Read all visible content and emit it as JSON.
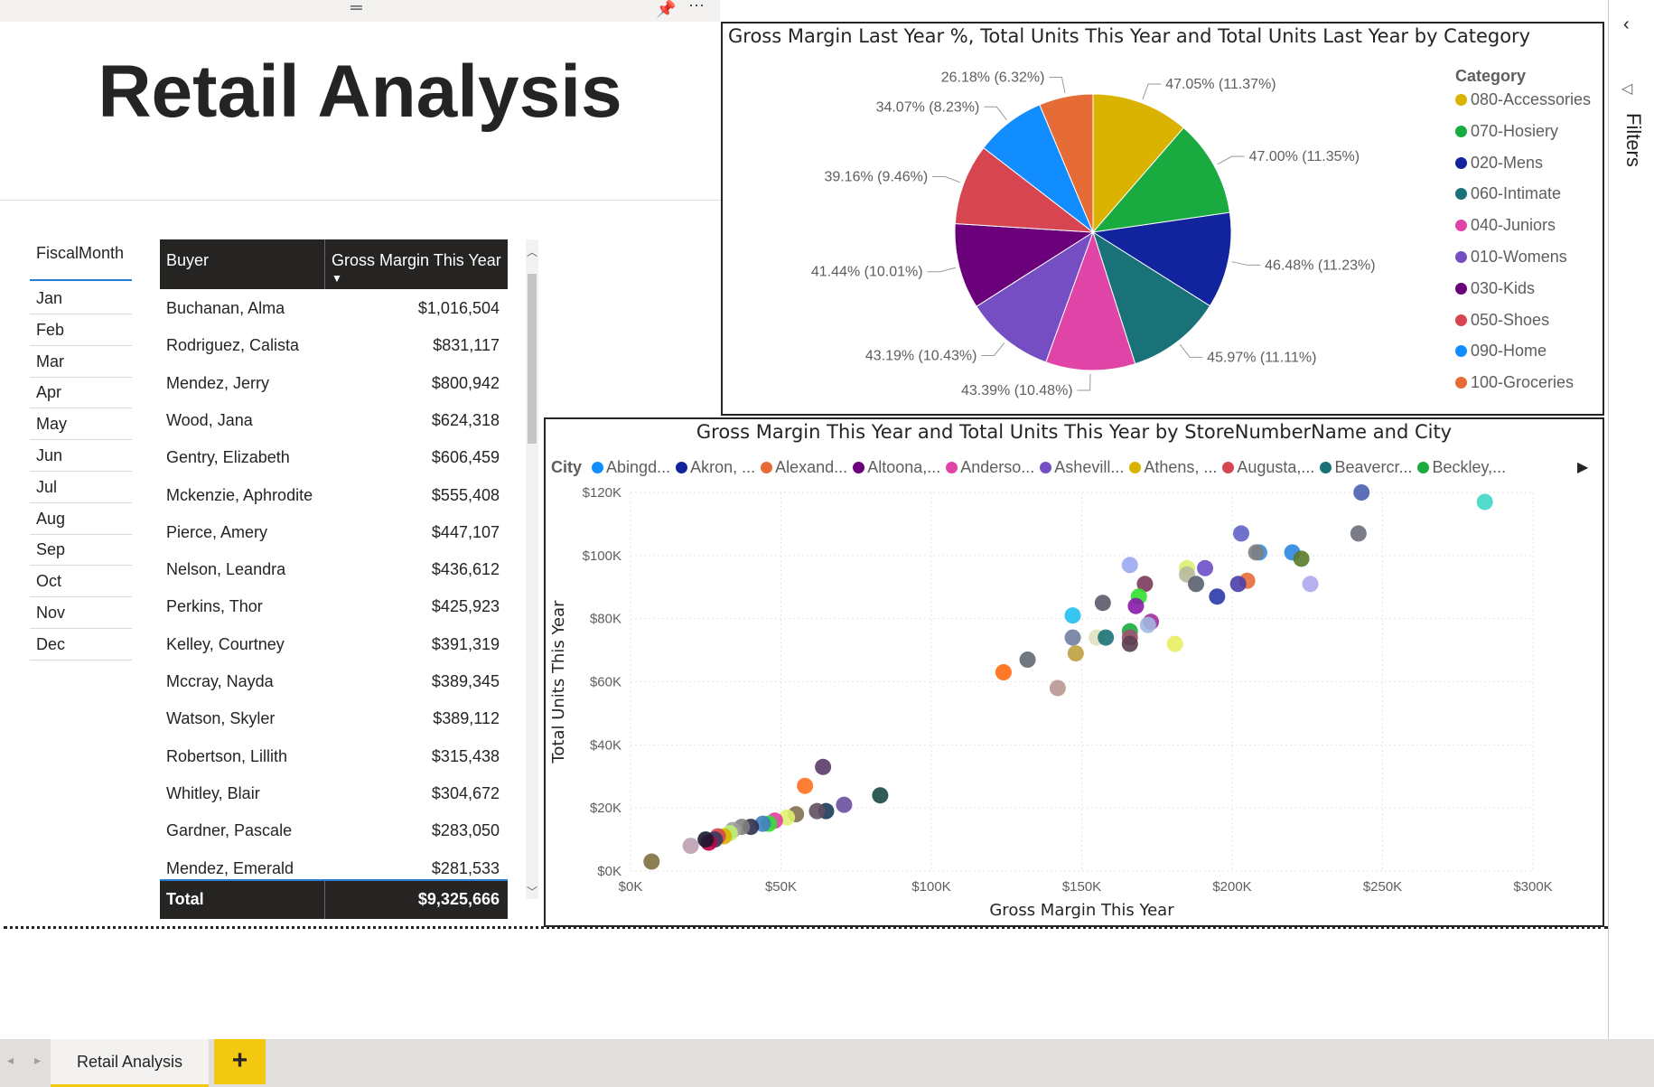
{
  "report": {
    "title": "Retail Analysis"
  },
  "slicer": {
    "title": "FiscalMonth",
    "items": [
      "Jan",
      "Feb",
      "Mar",
      "Apr",
      "May",
      "Jun",
      "Jul",
      "Aug",
      "Sep",
      "Oct",
      "Nov",
      "Dec"
    ]
  },
  "table": {
    "headers": {
      "buyer": "Buyer",
      "gross_margin": "Gross Margin This Year"
    },
    "rows": [
      {
        "buyer": "Buchanan, Alma",
        "gm": "$1,016,504"
      },
      {
        "buyer": "Rodriguez, Calista",
        "gm": "$831,117"
      },
      {
        "buyer": "Mendez, Jerry",
        "gm": "$800,942"
      },
      {
        "buyer": "Wood, Jana",
        "gm": "$624,318"
      },
      {
        "buyer": "Gentry, Elizabeth",
        "gm": "$606,459"
      },
      {
        "buyer": "Mckenzie, Aphrodite",
        "gm": "$555,408"
      },
      {
        "buyer": "Pierce, Amery",
        "gm": "$447,107"
      },
      {
        "buyer": "Nelson, Leandra",
        "gm": "$436,612"
      },
      {
        "buyer": "Perkins, Thor",
        "gm": "$425,923"
      },
      {
        "buyer": "Kelley, Courtney",
        "gm": "$391,319"
      },
      {
        "buyer": "Mccray, Nayda",
        "gm": "$389,345"
      },
      {
        "buyer": "Watson, Skyler",
        "gm": "$389,112"
      },
      {
        "buyer": "Robertson, Lillith",
        "gm": "$315,438"
      },
      {
        "buyer": "Whitley, Blair",
        "gm": "$304,672"
      },
      {
        "buyer": "Gardner, Pascale",
        "gm": "$283,050"
      },
      {
        "buyer": "Mendez, Emerald",
        "gm": "$281,533"
      }
    ],
    "total": {
      "label": "Total",
      "value": "$9,325,666"
    }
  },
  "filters": {
    "label": "Filters"
  },
  "tabs": {
    "active": "Retail Analysis",
    "add": "+"
  },
  "chart_data": [
    {
      "type": "pie",
      "title": "Gross Margin Last Year %, Total Units This Year and Total Units Last Year by Category",
      "legend_title": "Category",
      "legend_position": "right",
      "categories": [
        "080-Accessories",
        "070-Hosiery",
        "020-Mens",
        "060-Intimate",
        "040-Juniors",
        "010-Womens",
        "030-Kids",
        "050-Shoes",
        "090-Home",
        "100-Groceries"
      ],
      "colors": [
        "#d9b300",
        "#1aab40",
        "#12239e",
        "#197278",
        "#e044a7",
        "#744ec2",
        "#6b007b",
        "#d64550",
        "#118dff",
        "#e66c37"
      ],
      "values": [
        11.37,
        11.35,
        11.23,
        11.11,
        10.48,
        10.43,
        10.01,
        9.46,
        8.23,
        6.32
      ],
      "data_labels": [
        "47.05% (11.37%)",
        "47.00% (11.35%)",
        "46.48% (11.23%)",
        "45.97% (11.11%)",
        "43.39% (10.48%)",
        "43.19% (10.43%)",
        "41.44% (10.01%)",
        "39.16% (9.46%)",
        "34.07% (8.23%)",
        "26.18% (6.32%)"
      ]
    },
    {
      "type": "scatter",
      "title": "Gross Margin This Year and Total Units This Year by StoreNumberName and City",
      "xlabel": "Gross Margin This Year",
      "ylabel": "Total Units This Year",
      "xlim": [
        0,
        300000
      ],
      "ylim": [
        0,
        120000
      ],
      "x_ticks": [
        "$0K",
        "$50K",
        "$100K",
        "$150K",
        "$200K",
        "$250K",
        "$300K"
      ],
      "y_ticks": [
        "$0K",
        "$20K",
        "$40K",
        "$60K",
        "$80K",
        "$100K",
        "$120K"
      ],
      "legend_title": "City",
      "legend_position": "top",
      "legend": [
        {
          "name": "Abingd...",
          "color": "#118dff"
        },
        {
          "name": "Akron, ...",
          "color": "#12239e"
        },
        {
          "name": "Alexand...",
          "color": "#e66c37"
        },
        {
          "name": "Altoona,...",
          "color": "#6b007b"
        },
        {
          "name": "Anderso...",
          "color": "#e044a7"
        },
        {
          "name": "Ashevill...",
          "color": "#744ec2"
        },
        {
          "name": "Athens, ...",
          "color": "#d9b300"
        },
        {
          "name": "Augusta,...",
          "color": "#d64550"
        },
        {
          "name": "Beavercr...",
          "color": "#197278"
        },
        {
          "name": "Beckley,...",
          "color": "#1aab40"
        }
      ],
      "points": [
        {
          "x": 243000,
          "y": 120000,
          "color": "#4a5fb0"
        },
        {
          "x": 284000,
          "y": 117000,
          "color": "#3fd6c6"
        },
        {
          "x": 242000,
          "y": 107000,
          "color": "#6b6f7a"
        },
        {
          "x": 203000,
          "y": 107000,
          "color": "#6060c8"
        },
        {
          "x": 220000,
          "y": 101000,
          "color": "#2b86e0"
        },
        {
          "x": 209000,
          "y": 101000,
          "color": "#3b8ee8"
        },
        {
          "x": 208000,
          "y": 101000,
          "color": "#808080"
        },
        {
          "x": 223000,
          "y": 99000,
          "color": "#5a7a2a"
        },
        {
          "x": 166000,
          "y": 97000,
          "color": "#9aa8f0"
        },
        {
          "x": 185000,
          "y": 96000,
          "color": "#d8f070"
        },
        {
          "x": 191000,
          "y": 96000,
          "color": "#6a4fc8"
        },
        {
          "x": 185000,
          "y": 94000,
          "color": "#b8b8a0"
        },
        {
          "x": 205000,
          "y": 92000,
          "color": "#e66c37"
        },
        {
          "x": 171000,
          "y": 91000,
          "color": "#7a3a5a"
        },
        {
          "x": 188000,
          "y": 91000,
          "color": "#5a6070"
        },
        {
          "x": 202000,
          "y": 91000,
          "color": "#4a3ea8"
        },
        {
          "x": 226000,
          "y": 91000,
          "color": "#b0a8f0"
        },
        {
          "x": 195000,
          "y": 87000,
          "color": "#2a3aa8"
        },
        {
          "x": 169000,
          "y": 87000,
          "color": "#30e030"
        },
        {
          "x": 157000,
          "y": 85000,
          "color": "#5a5a6a"
        },
        {
          "x": 168000,
          "y": 84000,
          "color": "#8a1aa8"
        },
        {
          "x": 147000,
          "y": 81000,
          "color": "#20c0f0"
        },
        {
          "x": 173000,
          "y": 79000,
          "color": "#a030a0"
        },
        {
          "x": 172000,
          "y": 78000,
          "color": "#a0b8e0"
        },
        {
          "x": 166000,
          "y": 76000,
          "color": "#1aab40"
        },
        {
          "x": 155000,
          "y": 74000,
          "color": "#e0e0c0"
        },
        {
          "x": 158000,
          "y": 74000,
          "color": "#197278"
        },
        {
          "x": 147000,
          "y": 74000,
          "color": "#7080a0"
        },
        {
          "x": 166000,
          "y": 74000,
          "color": "#a05070"
        },
        {
          "x": 166000,
          "y": 72000,
          "color": "#5a4050"
        },
        {
          "x": 181000,
          "y": 72000,
          "color": "#e8f060"
        },
        {
          "x": 148000,
          "y": 69000,
          "color": "#c0a040"
        },
        {
          "x": 132000,
          "y": 67000,
          "color": "#606870"
        },
        {
          "x": 124000,
          "y": 63000,
          "color": "#ff6a10"
        },
        {
          "x": 142000,
          "y": 58000,
          "color": "#b89890"
        },
        {
          "x": 83000,
          "y": 24000,
          "color": "#1a4a40"
        },
        {
          "x": 64000,
          "y": 33000,
          "color": "#5a3a6a"
        },
        {
          "x": 58000,
          "y": 27000,
          "color": "#ff7020"
        },
        {
          "x": 71000,
          "y": 21000,
          "color": "#6a4fa0"
        },
        {
          "x": 65000,
          "y": 19000,
          "color": "#1a3a5a"
        },
        {
          "x": 62000,
          "y": 19000,
          "color": "#605060"
        },
        {
          "x": 55000,
          "y": 18000,
          "color": "#807050"
        },
        {
          "x": 52000,
          "y": 17000,
          "color": "#e0f070"
        },
        {
          "x": 48000,
          "y": 16000,
          "color": "#e040a0"
        },
        {
          "x": 46000,
          "y": 15000,
          "color": "#30e030"
        },
        {
          "x": 44000,
          "y": 15000,
          "color": "#4080c0"
        },
        {
          "x": 40000,
          "y": 14000,
          "color": "#303050"
        },
        {
          "x": 37000,
          "y": 14000,
          "color": "#808080"
        },
        {
          "x": 34000,
          "y": 13000,
          "color": "#a0a0a0"
        },
        {
          "x": 33000,
          "y": 12000,
          "color": "#c0f070"
        },
        {
          "x": 31000,
          "y": 11000,
          "color": "#d9b300"
        },
        {
          "x": 29000,
          "y": 11000,
          "color": "#d64550"
        },
        {
          "x": 28000,
          "y": 10000,
          "color": "#3a3a60"
        },
        {
          "x": 26000,
          "y": 9000,
          "color": "#c00040"
        },
        {
          "x": 25000,
          "y": 10000,
          "color": "#1a1a30"
        },
        {
          "x": 20000,
          "y": 8000,
          "color": "#c0a0b0"
        },
        {
          "x": 7000,
          "y": 3000,
          "color": "#807040"
        }
      ]
    }
  ]
}
